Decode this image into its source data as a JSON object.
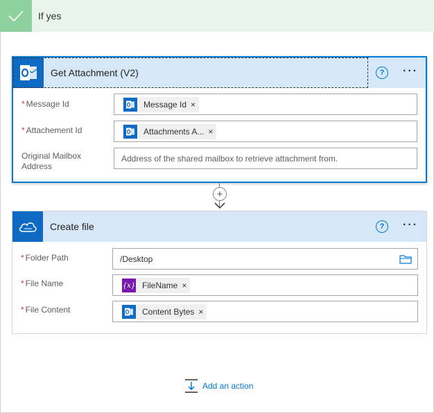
{
  "branch": {
    "title": "If yes"
  },
  "get_attachment": {
    "title": "Get Attachment (V2)",
    "help": "?",
    "more": "···",
    "fields": {
      "message_id": {
        "label": "Message Id",
        "token": "Message Id",
        "required": "*"
      },
      "attachment_id": {
        "label": "Attachement Id",
        "token": "Attachments A...",
        "required": "*"
      },
      "mailbox": {
        "label_line1": "Original Mailbox",
        "label_line2": "Address",
        "placeholder": "Address of the shared mailbox to retrieve attachment from."
      }
    }
  },
  "create_file": {
    "title": "Create file",
    "help": "?",
    "more": "···",
    "fields": {
      "folder_path": {
        "label": "Folder Path",
        "value": "/Desktop",
        "required": "*"
      },
      "file_name": {
        "label": "File Name",
        "token": "FileName",
        "token_icon": "{x}",
        "required": "*"
      },
      "file_content": {
        "label": "File Content",
        "token": "Content Bytes",
        "required": "*"
      }
    }
  },
  "connector": {
    "plus": "+"
  },
  "add_action": {
    "label": "Add an action"
  },
  "token_remove": "×",
  "colors": {
    "accent": "#0078d4",
    "outlook": "#0f6ac4",
    "expression": "#7719aa",
    "branch_check": "#8fd19e",
    "card_header": "#d6e7f7"
  }
}
